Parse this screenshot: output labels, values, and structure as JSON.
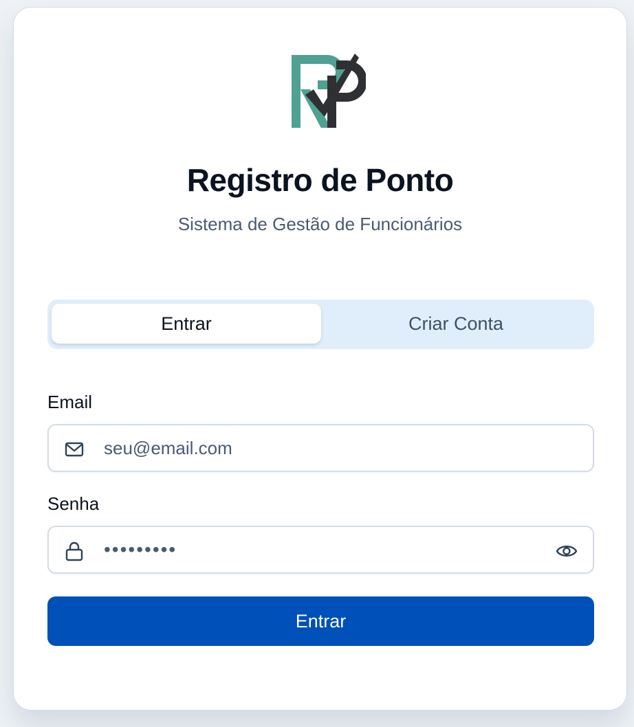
{
  "header": {
    "title": "Registro de Ponto",
    "subtitle": "Sistema de Gestão de Funcionários"
  },
  "tabs": [
    {
      "label": "Entrar",
      "active": true
    },
    {
      "label": "Criar Conta",
      "active": false
    }
  ],
  "form": {
    "email": {
      "label": "Email",
      "placeholder": "seu@email.com",
      "value": "",
      "icon": "mail-icon"
    },
    "password": {
      "label": "Senha",
      "masked_value": "•••••••••",
      "icon": "lock-icon",
      "toggle_icon": "eye-icon"
    },
    "submit_label": "Entrar"
  },
  "colors": {
    "primary": "#0050b9",
    "tab_background": "#e0eefb",
    "logo_teal": "#4fa192",
    "logo_dark": "#2f3033",
    "title_text": "#0b1220",
    "muted_text": "#4a5b70"
  }
}
